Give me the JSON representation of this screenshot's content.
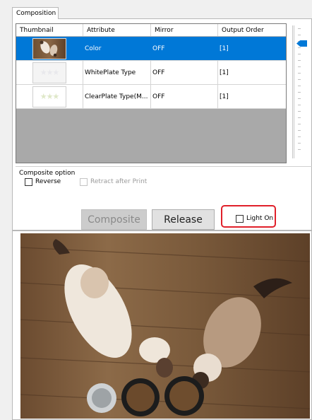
{
  "tab": {
    "label": "Composition"
  },
  "table": {
    "columns": [
      "Thumbnail",
      "Attribute",
      "Mirror",
      "Output Order"
    ],
    "rows": [
      {
        "attribute": "Color",
        "mirror": "OFF",
        "order": "[1]",
        "selected": true,
        "thumb": "cat-photo-thumbnail"
      },
      {
        "attribute": "WhitePlate Type",
        "mirror": "OFF",
        "order": "[1]",
        "selected": false,
        "thumb": "star-pattern-gray"
      },
      {
        "attribute": "ClearPlate Type(M...",
        "mirror": "OFF",
        "order": "[1]",
        "selected": false,
        "thumb": "star-pattern-green"
      }
    ]
  },
  "composite_option": {
    "title": "Composite option",
    "reverse_label": "Reverse",
    "reverse_checked": false,
    "retract_label": "Retract after Print",
    "retract_checked": false,
    "retract_enabled": false
  },
  "buttons": {
    "composite": "Composite",
    "release": "Release",
    "light_on": "Light On",
    "light_on_checked": false
  },
  "colors": {
    "selection": "#0078d7",
    "highlight": "#e0202a",
    "disabled_button": "#cccccc"
  },
  "preview": {
    "image": "two-siamese-cats-eating-on-wooden-floor"
  }
}
